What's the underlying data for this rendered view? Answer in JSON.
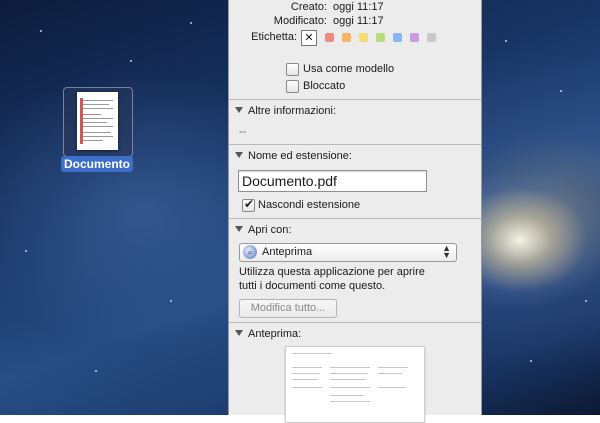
{
  "desktop": {
    "icon_label": "Documento"
  },
  "info": {
    "created_label": "Creato:",
    "created_value": "oggi 11:17",
    "modified_label": "Modificato:",
    "modified_value": "oggi 11:17",
    "tag_label": "Etichetta:",
    "tag_none_symbol": "✕",
    "tag_colors": [
      "#ef8a7e",
      "#f6b56a",
      "#f2de74",
      "#b9dc7b",
      "#86b7ef",
      "#c99be0",
      "#c9c9c9"
    ],
    "stationery_label": "Usa come modello",
    "locked_label": "Bloccato"
  },
  "more_info": {
    "title": "Altre informazioni:",
    "value": "--"
  },
  "name_ext": {
    "title": "Nome ed estensione:",
    "filename": "Documento.pdf",
    "hide_ext_label": "Nascondi estensione"
  },
  "open_with": {
    "title": "Apri con:",
    "app": "Anteprima",
    "desc_line1": "Utilizza questa applicazione per aprire",
    "desc_line2": "tutti i documenti come questo.",
    "change_all_label": "Modifica tutto..."
  },
  "preview": {
    "title": "Anteprima:"
  }
}
